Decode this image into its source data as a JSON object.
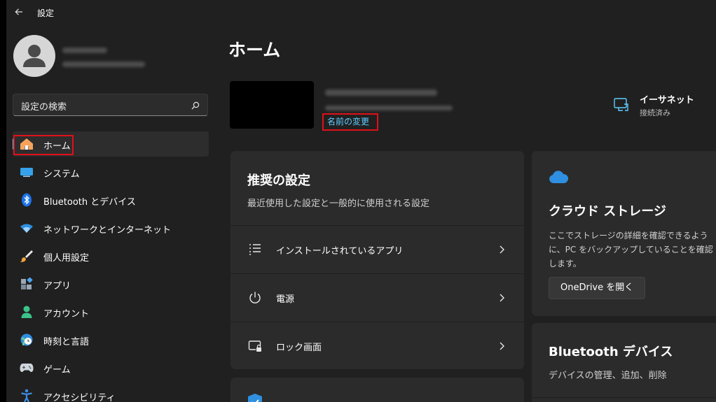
{
  "window": {
    "title": "設定"
  },
  "user": {
    "name_redacted": true
  },
  "search": {
    "placeholder": "設定の検索"
  },
  "sidebar": {
    "items": [
      {
        "label": "ホーム",
        "icon": "home-icon"
      },
      {
        "label": "システム",
        "icon": "system-icon"
      },
      {
        "label": "Bluetooth とデバイス",
        "icon": "bluetooth-icon"
      },
      {
        "label": "ネットワークとインターネット",
        "icon": "network-icon"
      },
      {
        "label": "個人用設定",
        "icon": "brush-icon"
      },
      {
        "label": "アプリ",
        "icon": "apps-icon"
      },
      {
        "label": "アカウント",
        "icon": "account-icon"
      },
      {
        "label": "時刻と言語",
        "icon": "globe-clock-icon"
      },
      {
        "label": "ゲーム",
        "icon": "gamepad-icon"
      },
      {
        "label": "アクセシビリティ",
        "icon": "accessibility-icon"
      }
    ]
  },
  "main": {
    "title": "ホーム",
    "rename_link": "名前の変更",
    "network": {
      "title": "イーサネット",
      "status": "接続済み"
    },
    "recommended": {
      "title": "推奨の設定",
      "subtitle": "最近使用した設定と一般的に使用される設定",
      "rows": [
        {
          "label": "インストールされているアプリ",
          "icon": "list-icon"
        },
        {
          "label": "電源",
          "icon": "power-icon"
        },
        {
          "label": "ロック画面",
          "icon": "lock-screen-icon"
        }
      ]
    },
    "cloud": {
      "title": "クラウド ストレージ",
      "description": "ここでストレージの詳細を確認できるように、PC をバックアップしていることを確認します。",
      "button": "OneDrive を開く"
    },
    "bluetooth": {
      "title": "Bluetooth デバイス",
      "subtitle": "デバイスの管理、追加、削除"
    }
  },
  "colors": {
    "accent": "#60cdff",
    "highlight_box": "#e0101a",
    "background": "#202020",
    "card": "#2b2b2b"
  }
}
